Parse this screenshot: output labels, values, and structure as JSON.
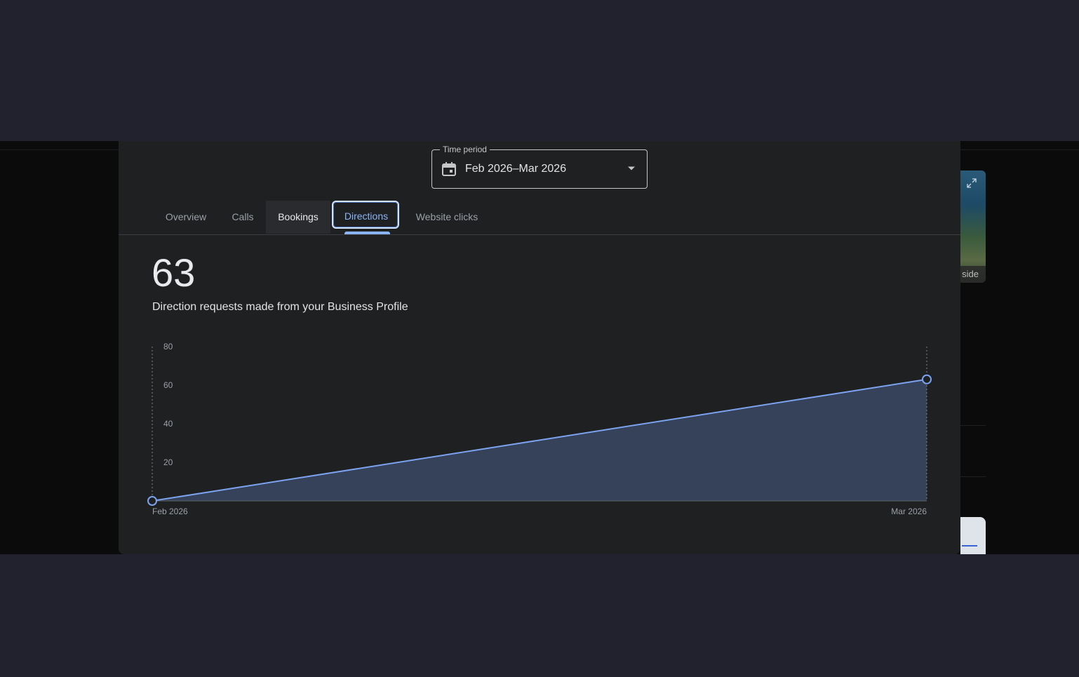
{
  "time_period": {
    "label": "Time period",
    "value": "Feb 2026–Mar 2026",
    "icon": "calendar-icon"
  },
  "tabs": [
    {
      "label": "Overview"
    },
    {
      "label": "Calls"
    },
    {
      "label": "Bookings"
    },
    {
      "label": "Directions",
      "selected": true
    },
    {
      "label": "Website clicks"
    }
  ],
  "metric": {
    "value": "63",
    "caption": "Direction requests made from your Business Profile"
  },
  "background": {
    "image_label": "side"
  },
  "colors": {
    "accent": "#8ab4f8",
    "line": "#7ba3ef",
    "area": "#36425a",
    "surface": "#1f2022"
  },
  "chart_data": {
    "type": "area",
    "x": [
      "Feb 2026",
      "Mar 2026"
    ],
    "series": [
      {
        "values": [
          0,
          63
        ]
      }
    ],
    "ylim": [
      0,
      80
    ],
    "yticks": [
      20,
      40,
      60,
      80
    ],
    "xlabel": "",
    "ylabel": "",
    "grid": false
  }
}
